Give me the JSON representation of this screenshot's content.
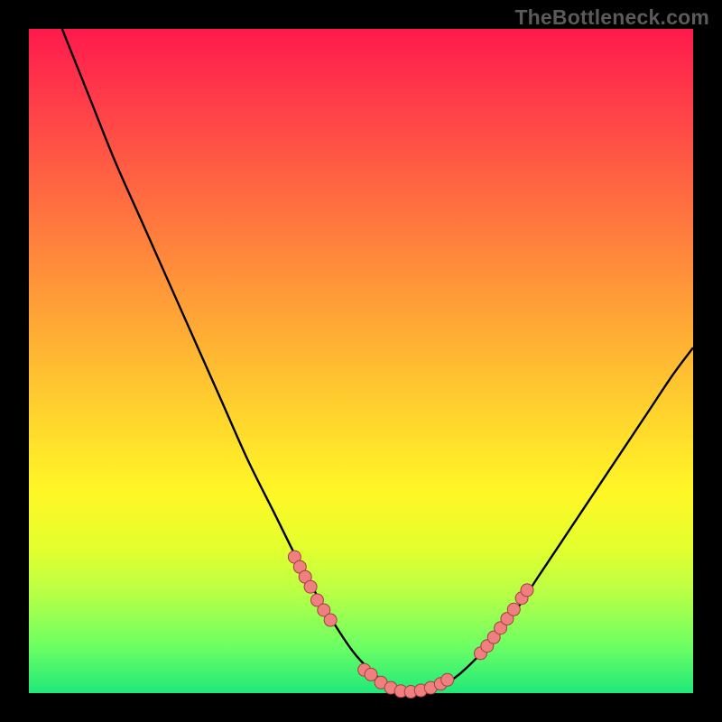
{
  "attribution": "TheBottleneck.com",
  "colors": {
    "background": "#000000",
    "gradient_top": "#ff1a4d",
    "gradient_bottom": "#20e87a",
    "curve_stroke": "#000000",
    "marker_fill": "#f08080",
    "marker_stroke": "#a04040"
  },
  "chart_data": {
    "type": "line",
    "title": "",
    "xlabel": "",
    "ylabel": "",
    "xlim": [
      0,
      100
    ],
    "ylim": [
      0,
      100
    ],
    "series": [
      {
        "name": "bottleneck-curve",
        "x": [
          5,
          9,
          13,
          17,
          21,
          25,
          29,
          33,
          37,
          41,
          45,
          49,
          53,
          56,
          59,
          62,
          65,
          69,
          73,
          77,
          81,
          85,
          89,
          93,
          97,
          100
        ],
        "values": [
          100,
          90,
          80,
          71,
          62,
          53,
          44,
          35,
          27,
          19,
          12,
          6,
          2,
          0,
          0,
          1,
          3,
          7,
          12,
          18,
          24,
          30,
          36,
          42,
          48,
          52
        ]
      }
    ],
    "marker_clusters": [
      {
        "name": "left-cluster",
        "points": [
          {
            "x": 40.0,
            "y": 20.5
          },
          {
            "x": 40.8,
            "y": 19.0
          },
          {
            "x": 41.6,
            "y": 17.5
          },
          {
            "x": 42.4,
            "y": 16.0
          },
          {
            "x": 43.4,
            "y": 14.0
          },
          {
            "x": 44.4,
            "y": 12.5
          },
          {
            "x": 45.4,
            "y": 11.0
          }
        ]
      },
      {
        "name": "valley-cluster",
        "points": [
          {
            "x": 50.5,
            "y": 3.5
          },
          {
            "x": 51.5,
            "y": 2.8
          },
          {
            "x": 53.0,
            "y": 1.6
          },
          {
            "x": 54.5,
            "y": 0.8
          },
          {
            "x": 56.0,
            "y": 0.3
          },
          {
            "x": 57.5,
            "y": 0.2
          },
          {
            "x": 59.0,
            "y": 0.4
          },
          {
            "x": 60.5,
            "y": 0.8
          },
          {
            "x": 62.0,
            "y": 1.4
          },
          {
            "x": 63.0,
            "y": 2.0
          }
        ]
      },
      {
        "name": "right-cluster",
        "points": [
          {
            "x": 68.0,
            "y": 6.0
          },
          {
            "x": 69.0,
            "y": 7.1
          },
          {
            "x": 70.0,
            "y": 8.4
          },
          {
            "x": 71.0,
            "y": 9.8
          },
          {
            "x": 72.0,
            "y": 11.2
          },
          {
            "x": 73.0,
            "y": 12.6
          },
          {
            "x": 74.2,
            "y": 14.3
          },
          {
            "x": 75.0,
            "y": 15.5
          }
        ]
      }
    ]
  }
}
